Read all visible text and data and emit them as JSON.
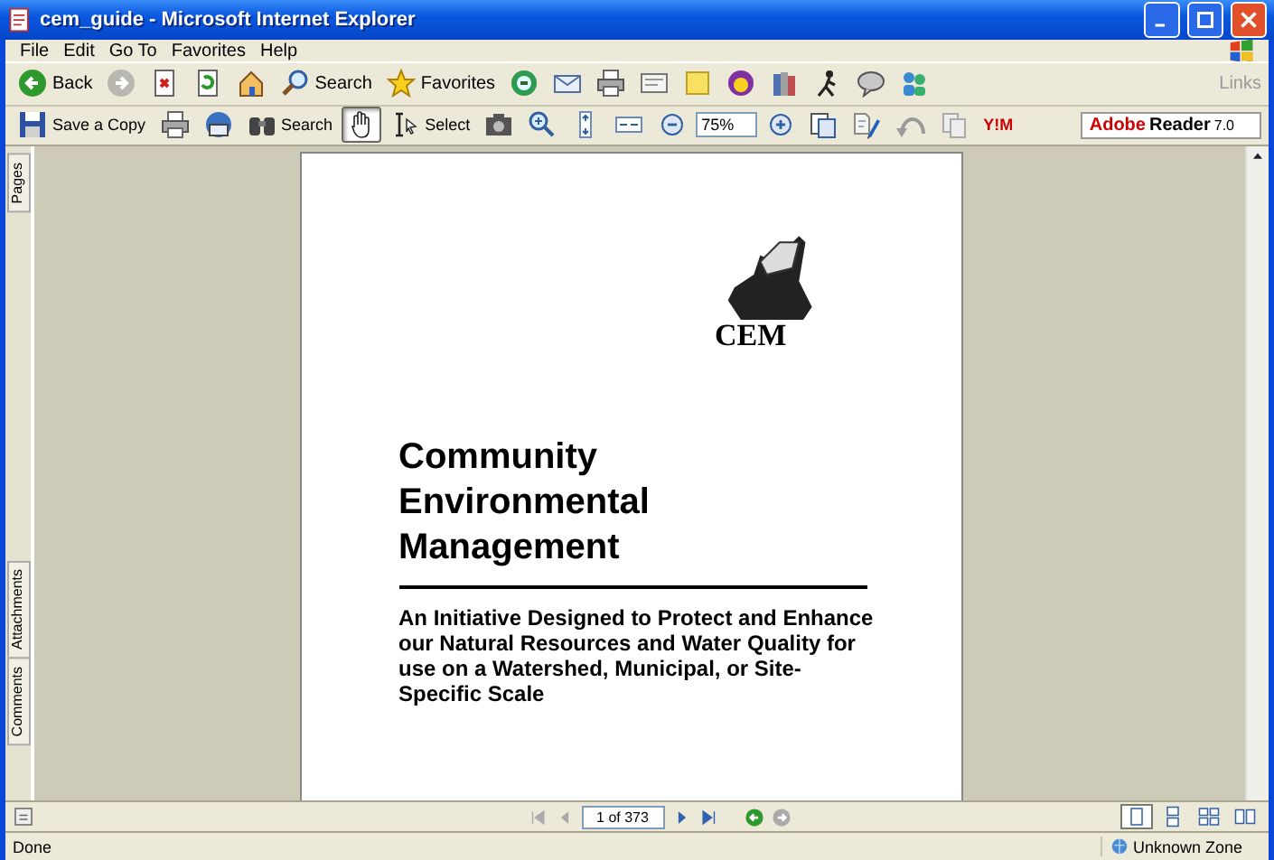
{
  "window": {
    "title": "cem_guide - Microsoft Internet Explorer"
  },
  "menu": [
    "File",
    "Edit",
    "Go To",
    "Favorites",
    "Help"
  ],
  "browser_toolbar": {
    "items": [
      {
        "kind": "back",
        "label": "Back"
      },
      {
        "kind": "forward"
      },
      {
        "kind": "stop"
      },
      {
        "kind": "refresh"
      },
      {
        "kind": "home"
      },
      {
        "kind": "search",
        "label": "Search"
      },
      {
        "kind": "favorites",
        "label": "Favorites"
      },
      {
        "kind": "media"
      },
      {
        "kind": "mail"
      },
      {
        "kind": "print"
      },
      {
        "kind": "edit"
      },
      {
        "kind": "note"
      },
      {
        "kind": "messenger"
      },
      {
        "kind": "research"
      },
      {
        "kind": "runner"
      },
      {
        "kind": "chat"
      },
      {
        "kind": "people"
      }
    ],
    "links": "Links"
  },
  "reader_toolbar": {
    "items": [
      {
        "kind": "save",
        "label": "Save a Copy",
        "pressed": false
      },
      {
        "kind": "print",
        "pressed": false
      },
      {
        "kind": "email",
        "pressed": false
      },
      {
        "kind": "binoculars",
        "label": "Search",
        "pressed": false
      },
      {
        "kind": "hand",
        "pressed": true
      },
      {
        "kind": "select",
        "label": "Select",
        "pressed": false
      },
      {
        "kind": "camera",
        "pressed": false
      },
      {
        "kind": "zoom",
        "pressed": false
      },
      {
        "kind": "fit-page",
        "pressed": false
      },
      {
        "kind": "fit-width",
        "pressed": false
      },
      {
        "kind": "minus",
        "pressed": false
      },
      {
        "kind": "zoom-field",
        "value": "75%"
      },
      {
        "kind": "plus",
        "pressed": false
      },
      {
        "kind": "pages",
        "pressed": false
      },
      {
        "kind": "review",
        "pressed": false
      },
      {
        "kind": "undo",
        "pressed": false
      },
      {
        "kind": "copy",
        "pressed": false
      },
      {
        "kind": "yim",
        "label": "Y!M",
        "pressed": false
      }
    ],
    "logo": {
      "brand": "Adobe",
      "product": "Reader",
      "version": "7.0"
    }
  },
  "side_tabs": [
    "Pages",
    "Attachments",
    "Comments"
  ],
  "document": {
    "logo_text": "CEM",
    "title": "Community Environmental Management",
    "subtitle": "An Initiative Designed to Protect and Enhance our Natural Resources and Water Quality for use on a Watershed, Municipal, or Site-Specific Scale"
  },
  "page_nav": {
    "page": "1 of 373",
    "views": [
      {
        "kind": "single",
        "selected": true
      },
      {
        "kind": "continuous",
        "selected": false
      },
      {
        "kind": "facing",
        "selected": false
      },
      {
        "kind": "continuous-facing",
        "selected": false
      }
    ]
  },
  "status_bar": {
    "status": "Done",
    "zone": "Unknown Zone"
  }
}
